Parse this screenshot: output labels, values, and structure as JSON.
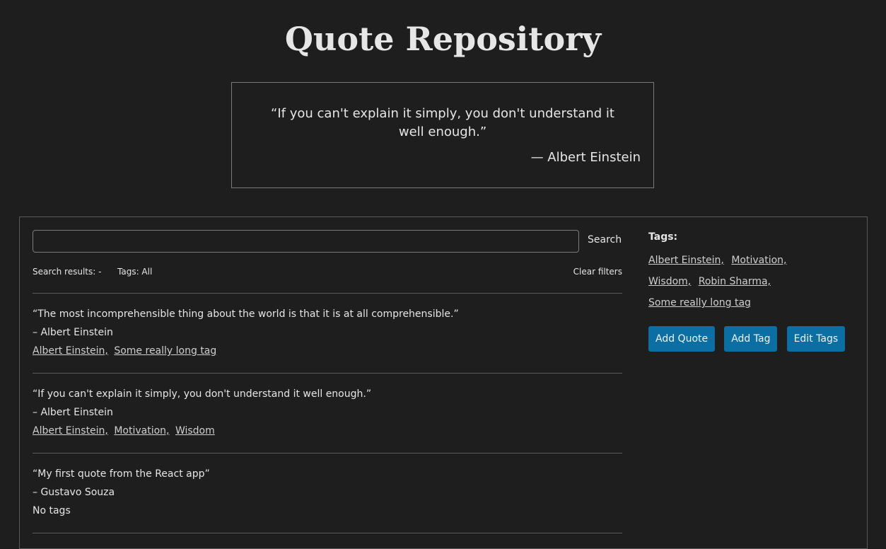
{
  "app": {
    "title": "Quote Repository"
  },
  "featured": {
    "text": "“If you can't explain it simply, you don't understand it well enough.”",
    "author": "— Albert Einstein"
  },
  "search": {
    "value": "",
    "placeholder": "",
    "button_label": "Search"
  },
  "filters": {
    "results": "Search results: -",
    "tags": "Tags: All",
    "clear": "Clear filters"
  },
  "quotes": [
    {
      "text": "“The most incomprehensible thing about the world is that it is at all comprehensible.”",
      "author": "– Albert Einstein",
      "tags": [
        "Albert Einstein,",
        "Some really long tag"
      ]
    },
    {
      "text": "“If you can't explain it simply, you don't understand it well enough.”",
      "author": "– Albert Einstein",
      "tags": [
        "Albert Einstein,",
        "Motivation,",
        "Wisdom"
      ]
    },
    {
      "text": "“My first quote from the React app”",
      "author": "– Gustavo Souza",
      "no_tags": "No tags"
    }
  ],
  "sidebar": {
    "title": "Tags:",
    "tags": [
      "Albert Einstein,",
      "Motivation,",
      "Wisdom,",
      "Robin Sharma,",
      "Some really long tag"
    ],
    "buttons": {
      "add_quote": "Add Quote",
      "add_tag": "Add Tag",
      "edit_tags": "Edit Tags"
    }
  },
  "colors": {
    "background": "#1e1e1e",
    "text": "#e6e6e6",
    "accent": "#0b6fa4",
    "border": "#5a5a5a"
  }
}
